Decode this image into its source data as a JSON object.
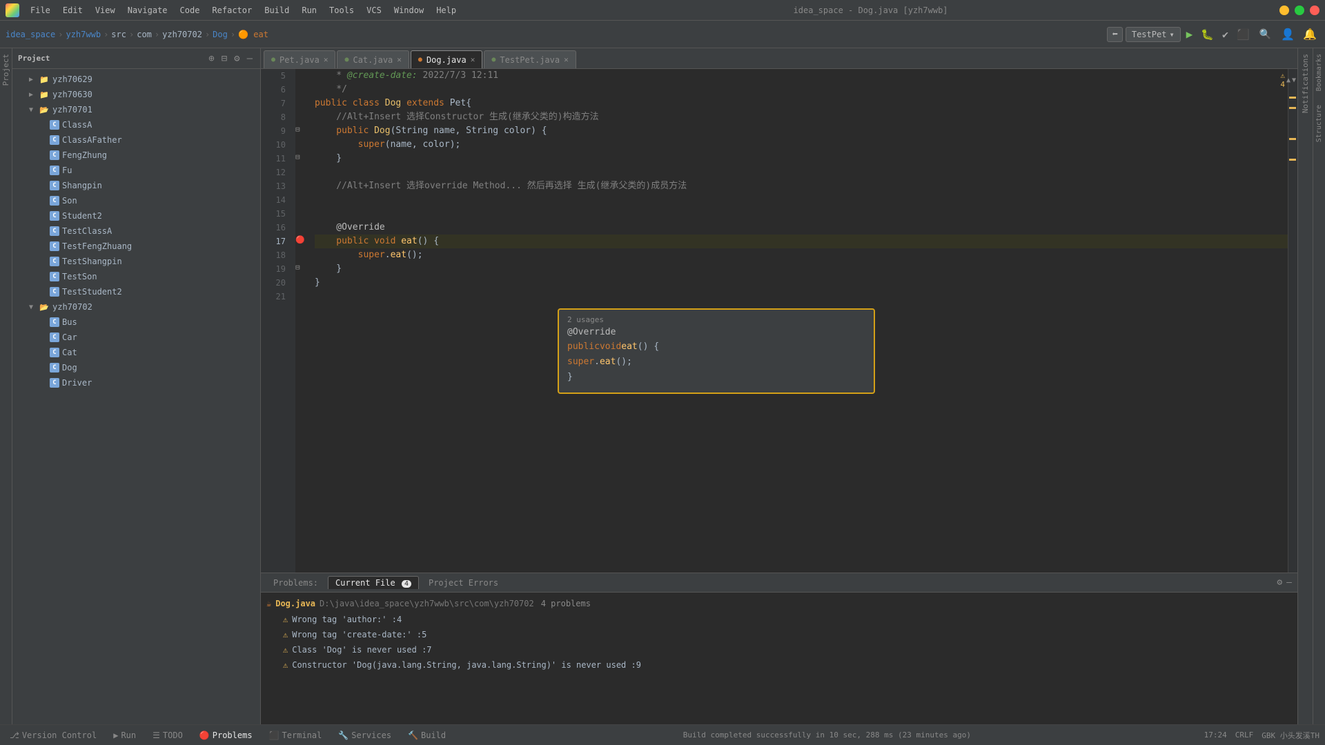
{
  "titlebar": {
    "title": "idea_space - Dog.java [yzh7wwb]",
    "menus": [
      "File",
      "Edit",
      "View",
      "Navigate",
      "Code",
      "Refactor",
      "Build",
      "Run",
      "Tools",
      "VCS",
      "Window",
      "Help"
    ]
  },
  "toolbar": {
    "breadcrumb": [
      "idea_space",
      "yzh7wwb",
      "src",
      "com",
      "yzh70702",
      "Dog",
      "eat"
    ],
    "run_config": "TestPet"
  },
  "sidebar": {
    "title": "Project",
    "tree": [
      {
        "label": "yzh70629",
        "level": 2,
        "type": "folder",
        "expanded": false
      },
      {
        "label": "yzh70630",
        "level": 2,
        "type": "folder",
        "expanded": false
      },
      {
        "label": "yzh70701",
        "level": 2,
        "type": "folder",
        "expanded": true
      },
      {
        "label": "ClassA",
        "level": 3,
        "type": "java-c"
      },
      {
        "label": "ClassAFather",
        "level": 3,
        "type": "java-c"
      },
      {
        "label": "FengZhung",
        "level": 3,
        "type": "java-c"
      },
      {
        "label": "Fu",
        "level": 3,
        "type": "java-c"
      },
      {
        "label": "Shangpin",
        "level": 3,
        "type": "java-c"
      },
      {
        "label": "Son",
        "level": 3,
        "type": "java-c"
      },
      {
        "label": "Student2",
        "level": 3,
        "type": "java-c"
      },
      {
        "label": "TestClassA",
        "level": 3,
        "type": "java-c"
      },
      {
        "label": "TestFengZhuang",
        "level": 3,
        "type": "java-c"
      },
      {
        "label": "TestShangpin",
        "level": 3,
        "type": "java-c"
      },
      {
        "label": "TestSon",
        "level": 3,
        "type": "java-c"
      },
      {
        "label": "TestStudent2",
        "level": 3,
        "type": "java-c"
      },
      {
        "label": "yzh70702",
        "level": 2,
        "type": "folder",
        "expanded": true
      },
      {
        "label": "Bus",
        "level": 3,
        "type": "java-c"
      },
      {
        "label": "Car",
        "level": 3,
        "type": "java-c"
      },
      {
        "label": "Cat",
        "level": 3,
        "type": "java-c"
      },
      {
        "label": "Dog",
        "level": 3,
        "type": "java-c"
      },
      {
        "label": "Driver",
        "level": 3,
        "type": "java-c"
      }
    ]
  },
  "tabs": [
    {
      "label": "Pet.java",
      "type": "green",
      "active": false
    },
    {
      "label": "Cat.java",
      "type": "green",
      "active": false
    },
    {
      "label": "Dog.java",
      "type": "orange",
      "active": true
    },
    {
      "label": "TestPet.java",
      "type": "green",
      "active": false
    }
  ],
  "editor": {
    "lines": [
      {
        "num": 5,
        "content": "    * @create-date: 2022/7/3 12:11"
      },
      {
        "num": 6,
        "content": "    */"
      },
      {
        "num": 7,
        "content": "public class Dog extends Pet{"
      },
      {
        "num": 8,
        "content": "    //Alt+Insert 选择Constructor 生成(继承父类的)构造方法"
      },
      {
        "num": 9,
        "content": "    public Dog(String name, String color) {"
      },
      {
        "num": 10,
        "content": "        super(name, color);"
      },
      {
        "num": 11,
        "content": "    }"
      },
      {
        "num": 12,
        "content": ""
      },
      {
        "num": 13,
        "content": "    //Alt+Insert 选择override Method... 然后再选择 生成(继承父类的)成员方法"
      },
      {
        "num": 14,
        "content": ""
      },
      {
        "num": 15,
        "content": ""
      },
      {
        "num": 16,
        "content": "    @Override"
      },
      {
        "num": 17,
        "content": "    public void eat() {",
        "gutter": true
      },
      {
        "num": 18,
        "content": "        super.eat();"
      },
      {
        "num": 19,
        "content": "    }"
      },
      {
        "num": 20,
        "content": "}"
      },
      {
        "num": 21,
        "content": ""
      }
    ]
  },
  "popup": {
    "usages": "2 usages",
    "annotation": "@Override",
    "code_line": "    public void eat() {",
    "body_line": "        super.eat();",
    "close_line": "    }"
  },
  "bottom_panel": {
    "tabs": [
      "Problems",
      "Current File 4",
      "Project Errors"
    ],
    "active_tab": "Current File 4",
    "file": "Dog.java",
    "file_path": "D:\\java\\idea_space\\yzh7wwb\\src\\com\\yzh70702",
    "problem_count": "4 problems",
    "problems": [
      "Wrong tag 'author:' :4",
      "Wrong tag 'create-date:' :5",
      "Class 'Dog' is never used :7",
      "Constructor 'Dog(java.lang.String, java.lang.String)' is never used :9"
    ]
  },
  "bottom_toolbar": {
    "items": [
      "Version Control",
      "Run",
      "TODO",
      "Problems",
      "Terminal",
      "Services",
      "Build"
    ]
  },
  "statusbar": {
    "message": "Build completed successfully in 10 sec, 288 ms (23 minutes ago)",
    "position": "17:24",
    "encoding": "CRLF",
    "charset": "GBK 小头发溪TH"
  },
  "notifications_label": "Notifications",
  "right_panel_labels": [
    "Project",
    "Bookmarks",
    "Structure"
  ]
}
